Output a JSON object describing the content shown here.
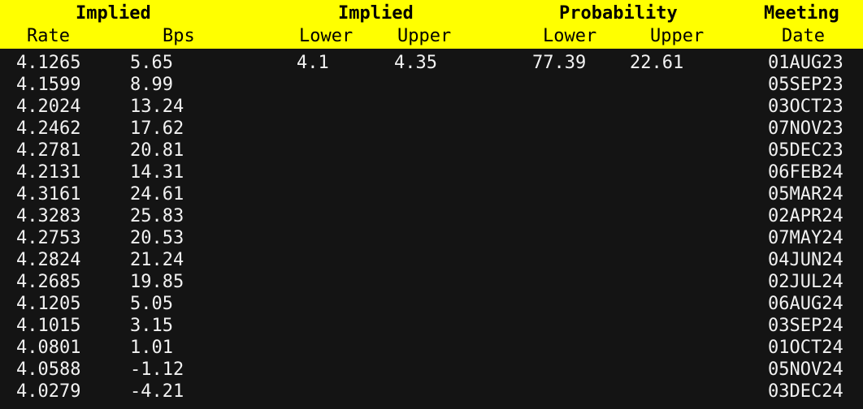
{
  "header": {
    "groups": {
      "implied_rate_group": "Implied",
      "implied_bounds_group": "Implied",
      "probability_group": "Probability",
      "meeting_group": "Meeting"
    },
    "columns": {
      "implied_rate": "Rate",
      "implied_bps": "Bps",
      "implied_lower": "Lower",
      "implied_upper": "Upper",
      "probability_lower": "Lower",
      "probability_upper": "Upper",
      "meeting_date": "Date"
    }
  },
  "colors": {
    "header_background": "#ffff00",
    "header_text": "#000000",
    "body_background": "#141414",
    "body_text": "#f2f2f2"
  },
  "rows": [
    {
      "implied_rate": "4.1265",
      "implied_bps": "5.65",
      "implied_lower": "4.1",
      "implied_upper": "4.35",
      "probability_lower": "77.39",
      "probability_upper": "22.61",
      "meeting_date": "01AUG23"
    },
    {
      "implied_rate": "4.1599",
      "implied_bps": "8.99",
      "implied_lower": "",
      "implied_upper": "",
      "probability_lower": "",
      "probability_upper": "",
      "meeting_date": "05SEP23"
    },
    {
      "implied_rate": "4.2024",
      "implied_bps": "13.24",
      "implied_lower": "",
      "implied_upper": "",
      "probability_lower": "",
      "probability_upper": "",
      "meeting_date": "03OCT23"
    },
    {
      "implied_rate": "4.2462",
      "implied_bps": "17.62",
      "implied_lower": "",
      "implied_upper": "",
      "probability_lower": "",
      "probability_upper": "",
      "meeting_date": "07NOV23"
    },
    {
      "implied_rate": "4.2781",
      "implied_bps": "20.81",
      "implied_lower": "",
      "implied_upper": "",
      "probability_lower": "",
      "probability_upper": "",
      "meeting_date": "05DEC23"
    },
    {
      "implied_rate": "4.2131",
      "implied_bps": "14.31",
      "implied_lower": "",
      "implied_upper": "",
      "probability_lower": "",
      "probability_upper": "",
      "meeting_date": "06FEB24"
    },
    {
      "implied_rate": "4.3161",
      "implied_bps": "24.61",
      "implied_lower": "",
      "implied_upper": "",
      "probability_lower": "",
      "probability_upper": "",
      "meeting_date": "05MAR24"
    },
    {
      "implied_rate": "4.3283",
      "implied_bps": "25.83",
      "implied_lower": "",
      "implied_upper": "",
      "probability_lower": "",
      "probability_upper": "",
      "meeting_date": "02APR24"
    },
    {
      "implied_rate": "4.2753",
      "implied_bps": "20.53",
      "implied_lower": "",
      "implied_upper": "",
      "probability_lower": "",
      "probability_upper": "",
      "meeting_date": "07MAY24"
    },
    {
      "implied_rate": "4.2824",
      "implied_bps": "21.24",
      "implied_lower": "",
      "implied_upper": "",
      "probability_lower": "",
      "probability_upper": "",
      "meeting_date": "04JUN24"
    },
    {
      "implied_rate": "4.2685",
      "implied_bps": "19.85",
      "implied_lower": "",
      "implied_upper": "",
      "probability_lower": "",
      "probability_upper": "",
      "meeting_date": "02JUL24"
    },
    {
      "implied_rate": "4.1205",
      "implied_bps": "5.05",
      "implied_lower": "",
      "implied_upper": "",
      "probability_lower": "",
      "probability_upper": "",
      "meeting_date": "06AUG24"
    },
    {
      "implied_rate": "4.1015",
      "implied_bps": "3.15",
      "implied_lower": "",
      "implied_upper": "",
      "probability_lower": "",
      "probability_upper": "",
      "meeting_date": "03SEP24"
    },
    {
      "implied_rate": "4.0801",
      "implied_bps": "1.01",
      "implied_lower": "",
      "implied_upper": "",
      "probability_lower": "",
      "probability_upper": "",
      "meeting_date": "01OCT24"
    },
    {
      "implied_rate": "4.0588",
      "implied_bps": "-1.12",
      "implied_lower": "",
      "implied_upper": "",
      "probability_lower": "",
      "probability_upper": "",
      "meeting_date": "05NOV24"
    },
    {
      "implied_rate": "4.0279",
      "implied_bps": "-4.21",
      "implied_lower": "",
      "implied_upper": "",
      "probability_lower": "",
      "probability_upper": "",
      "meeting_date": "03DEC24"
    }
  ]
}
